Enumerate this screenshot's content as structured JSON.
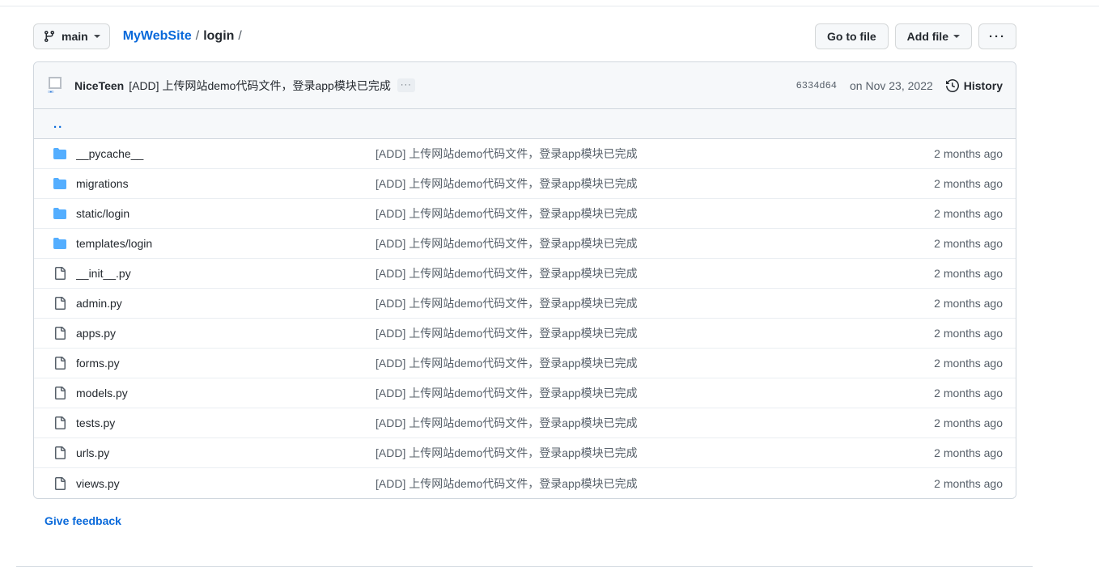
{
  "toolbar": {
    "branch": {
      "icon": "git-branch-icon",
      "label": "main",
      "caret": "chevron-down-icon"
    },
    "breadcrumb": {
      "repo": "MyWebSite",
      "sep1": "/",
      "current": "login",
      "sep2": "/"
    },
    "go_to_file_label": "Go to file",
    "add_file_label": "Add file",
    "kebab_label": "···"
  },
  "commit_bar": {
    "avatar": "broken-image-avatar",
    "avatar_glyph": "▫▪▫",
    "author": "NiceTeen",
    "message": "[ADD] 上传网站demo代码文件，登录app模块已完成",
    "expand_label": "···",
    "sha": "6334d64",
    "date": "on Nov 23, 2022",
    "history_label": "History",
    "history_icon": "clock-history-icon"
  },
  "parent_row": {
    "label": ".."
  },
  "file_list": [
    {
      "type": "folder",
      "name": "__pycache__",
      "message": "[ADD] 上传网站demo代码文件，登录app模块已完成",
      "time": "2 months ago"
    },
    {
      "type": "folder",
      "name": "migrations",
      "message": "[ADD] 上传网站demo代码文件，登录app模块已完成",
      "time": "2 months ago"
    },
    {
      "type": "folder",
      "name": "static/login",
      "message": "[ADD] 上传网站demo代码文件，登录app模块已完成",
      "time": "2 months ago"
    },
    {
      "type": "folder",
      "name": "templates/login",
      "message": "[ADD] 上传网站demo代码文件，登录app模块已完成",
      "time": "2 months ago"
    },
    {
      "type": "file",
      "name": "__init__.py",
      "message": "[ADD] 上传网站demo代码文件，登录app模块已完成",
      "time": "2 months ago"
    },
    {
      "type": "file",
      "name": "admin.py",
      "message": "[ADD] 上传网站demo代码文件，登录app模块已完成",
      "time": "2 months ago"
    },
    {
      "type": "file",
      "name": "apps.py",
      "message": "[ADD] 上传网站demo代码文件，登录app模块已完成",
      "time": "2 months ago"
    },
    {
      "type": "file",
      "name": "forms.py",
      "message": "[ADD] 上传网站demo代码文件，登录app模块已完成",
      "time": "2 months ago"
    },
    {
      "type": "file",
      "name": "models.py",
      "message": "[ADD] 上传网站demo代码文件，登录app模块已完成",
      "time": "2 months ago"
    },
    {
      "type": "file",
      "name": "tests.py",
      "message": "[ADD] 上传网站demo代码文件，登录app模块已完成",
      "time": "2 months ago"
    },
    {
      "type": "file",
      "name": "urls.py",
      "message": "[ADD] 上传网站demo代码文件，登录app模块已完成",
      "time": "2 months ago"
    },
    {
      "type": "file",
      "name": "views.py",
      "message": "[ADD] 上传网站demo代码文件，登录app模块已完成",
      "time": "2 months ago"
    }
  ],
  "footer": {
    "feedback_label": "Give feedback"
  },
  "colors": {
    "link": "#0969da",
    "text": "#24292f",
    "muted": "#57606a",
    "folder_icon": "#54aeff",
    "border": "#d0d7de",
    "header_bg": "#f6f8fa"
  }
}
